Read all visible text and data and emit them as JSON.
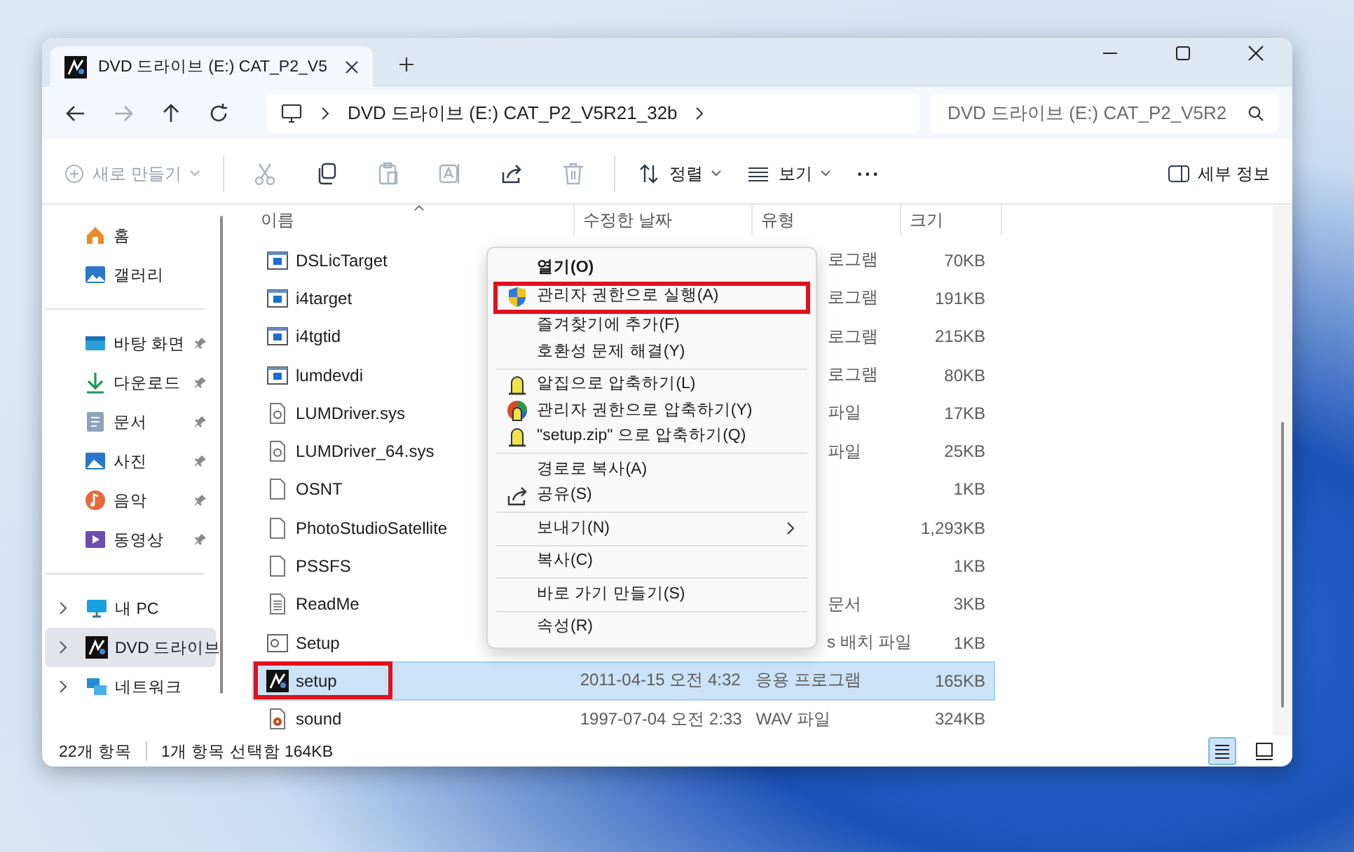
{
  "window": {
    "tab_title": "DVD 드라이브 (E:) CAT_P2_V5"
  },
  "address": {
    "path": "DVD 드라이브 (E:) CAT_P2_V5R21_32b"
  },
  "search": {
    "placeholder": "DVD 드라이브 (E:) CAT_P2_V5R2"
  },
  "toolbar": [
    {
      "kind": "new",
      "label": "새로 만들기",
      "disabled": true
    },
    {
      "kind": "cut",
      "disabled": true
    },
    {
      "kind": "copy",
      "disabled": false
    },
    {
      "kind": "paste",
      "disabled": true
    },
    {
      "kind": "rename",
      "disabled": true
    },
    {
      "kind": "share",
      "disabled": false
    },
    {
      "kind": "delete",
      "disabled": true
    },
    {
      "kind": "sort",
      "label": "정렬",
      "disabled": false
    },
    {
      "kind": "view",
      "label": "보기",
      "disabled": false
    },
    {
      "kind": "more",
      "label": "···",
      "disabled": false
    }
  ],
  "details_button": {
    "label": "세부 정보"
  },
  "sidebar": {
    "quick": [
      {
        "kind": "home",
        "label": "홈"
      },
      {
        "kind": "gallery",
        "label": "갤러리"
      }
    ],
    "pinned": [
      {
        "kind": "desktop",
        "label": "바탕 화면",
        "pinned": true
      },
      {
        "kind": "download",
        "label": "다운로드",
        "pinned": true
      },
      {
        "kind": "documents",
        "label": "문서",
        "pinned": true
      },
      {
        "kind": "pictures",
        "label": "사진",
        "pinned": true
      },
      {
        "kind": "music",
        "label": "음악",
        "pinned": true
      },
      {
        "kind": "videos",
        "label": "동영상",
        "pinned": true
      }
    ],
    "tree": [
      {
        "kind": "pc",
        "label": "내 PC",
        "selected": false
      },
      {
        "kind": "dvd",
        "label": "DVD 드라이브",
        "selected": true
      },
      {
        "kind": "network",
        "label": "네트워크",
        "selected": false
      }
    ]
  },
  "files": {
    "columns": [
      "이름",
      "수정한 날짜",
      "유형",
      "크기"
    ],
    "rows": [
      {
        "kind": "program",
        "name": "DSLicTarget",
        "type": "로그램",
        "type_covered": true,
        "size": "70KB",
        "selected": false,
        "highlighted": false
      },
      {
        "kind": "program",
        "name": "i4target",
        "type": "로그램",
        "type_covered": true,
        "size": "191KB",
        "selected": false,
        "highlighted": false
      },
      {
        "kind": "program",
        "name": "i4tgtid",
        "type": "로그램",
        "type_covered": true,
        "size": "215KB",
        "selected": false,
        "highlighted": false
      },
      {
        "kind": "program",
        "name": "lumdevdi",
        "type": "로그램",
        "type_covered": true,
        "size": "80KB",
        "selected": false,
        "highlighted": false
      },
      {
        "kind": "system",
        "name": "LUMDriver.sys",
        "type": "파일",
        "type_covered": true,
        "size": "17KB",
        "selected": false,
        "highlighted": false
      },
      {
        "kind": "system",
        "name": "LUMDriver_64.sys",
        "type": "파일",
        "type_covered": true,
        "size": "25KB",
        "selected": false,
        "highlighted": false
      },
      {
        "kind": "file",
        "name": "OSNT",
        "size": "1KB",
        "selected": false,
        "highlighted": false
      },
      {
        "kind": "file",
        "name": "PhotoStudioSatellite",
        "size": "1,293KB",
        "selected": false,
        "highlighted": false
      },
      {
        "kind": "file",
        "name": "PSSFS",
        "size": "1KB",
        "selected": false,
        "highlighted": false
      },
      {
        "kind": "text",
        "name": "ReadMe",
        "type": "문서",
        "type_covered": true,
        "size": "3KB",
        "selected": false,
        "highlighted": false
      },
      {
        "kind": "batch",
        "name": "Setup",
        "type": "s 배치 파일",
        "type_covered": true,
        "size": "1KB",
        "selected": false,
        "highlighted": false
      },
      {
        "kind": "app",
        "name": "setup",
        "date": "2011-04-15 오전 4:32",
        "type": "응용 프로그램",
        "size": "165KB",
        "selected": true,
        "highlighted": true
      },
      {
        "kind": "audio",
        "name": "sound",
        "date": "1997-07-04 오전 2:33",
        "type": "WAV 파일",
        "size": "324KB",
        "selected": false,
        "highlighted": false
      }
    ]
  },
  "context_menu": [
    [
      {
        "label": "열기(O)",
        "default": true
      },
      {
        "label": "관리자 권한으로 실행(A)",
        "kind": "shield",
        "highlighted": true
      },
      {
        "label": "즐겨찾기에 추가(F)"
      },
      {
        "label": "호환성 문제 해결(Y)"
      }
    ],
    [
      {
        "label": "알집으로 압축하기(L)",
        "kind": "zip"
      },
      {
        "label": "관리자 권한으로 압축하기(Y)",
        "kind": "zip-admin"
      },
      {
        "label": "\"setup.zip\" 으로 압축하기(Q)",
        "kind": "zip"
      }
    ],
    [
      {
        "label": "경로로 복사(A)"
      },
      {
        "label": "공유(S)",
        "kind": "share"
      }
    ],
    [
      {
        "label": "보내기(N)",
        "submenu": true
      }
    ],
    [
      {
        "label": "복사(C)"
      }
    ],
    [
      {
        "label": "바로 가기 만들기(S)"
      }
    ],
    [
      {
        "label": "속성(R)"
      }
    ]
  ],
  "status_bar": {
    "count": "22개 항목",
    "selection": "1개 항목 선택함 164KB"
  },
  "view_buttons": [
    {
      "kind": "details",
      "selected": true
    },
    {
      "kind": "tiles",
      "selected": false
    }
  ]
}
